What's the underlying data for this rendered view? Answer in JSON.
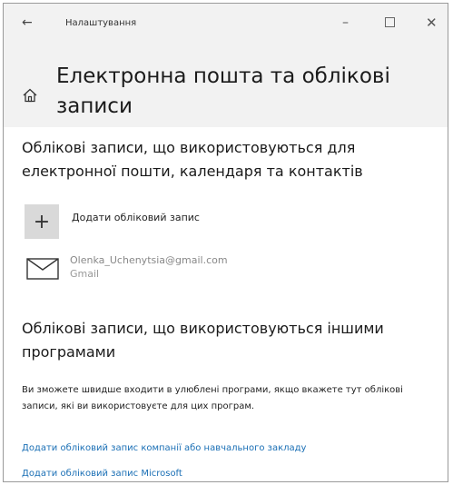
{
  "window": {
    "title": "Налаштування",
    "back_glyph": "←",
    "minimize_glyph": "–",
    "close_glyph": "✕"
  },
  "header": {
    "title": "Електронна пошта та облікові записи",
    "icon": "home-icon"
  },
  "email_section": {
    "title": "Облікові записи, що використовуються для електронної пошти, календаря та контактів",
    "add_account_label": "Додати обліковий запис",
    "add_account_glyph": "+",
    "accounts": [
      {
        "email": "Olenka_Uchenytsia@gmail.com",
        "provider": "Gmail",
        "icon": "mail-icon"
      }
    ]
  },
  "other_apps_section": {
    "title": "Облікові записи, що використовуються іншими програмами",
    "description": "Ви зможете швидше входити в улюблені програми, якщо вкажете тут облікові записи, які ви використовуєте для цих програм.",
    "links": [
      "Додати обліковий запис компанії або навчального закладу",
      "Додати обліковий запис Microsoft"
    ]
  },
  "colors": {
    "link": "#1a6fb5",
    "header_bg": "#f2f2f2",
    "tile_bg": "#d9d9d9"
  }
}
